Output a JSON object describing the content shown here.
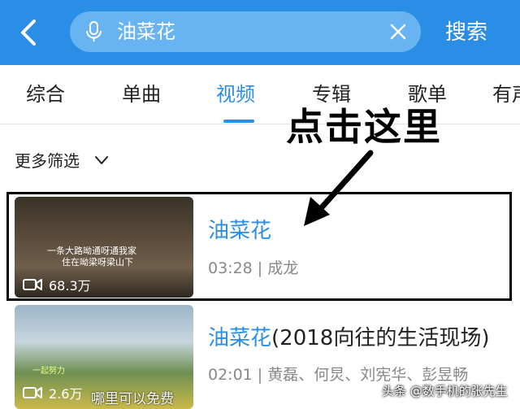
{
  "header": {
    "query": "油菜花",
    "search_button": "搜索"
  },
  "tabs": [
    "综合",
    "单曲",
    "视频",
    "专辑",
    "歌单",
    "有声"
  ],
  "active_tab": "视频",
  "filter": {
    "label": "更多筛选"
  },
  "annotation": "点击这里",
  "results": [
    {
      "title": "油菜花",
      "duration": "03:28",
      "artists": "成龙",
      "meta": "03:28 | 成龙",
      "plays": "68.3万",
      "thumb_caption_1": "一条大路呦通呀通我家",
      "thumb_caption_2": "住在呦梁呀梁山下"
    },
    {
      "title_main": "油菜花",
      "title_rest": "(2018向往的生活现场)",
      "meta": "02:01 | 黄磊、何炅、刘宪华、彭昱畅",
      "plays": "2.6万",
      "thumb_tag": "一起努力",
      "promo": "哪里可以免费"
    }
  ],
  "watermark": "头条 @数手机的张先生",
  "colors": {
    "accent": "#2a8ee6",
    "topbar": "#2a8ee6"
  }
}
